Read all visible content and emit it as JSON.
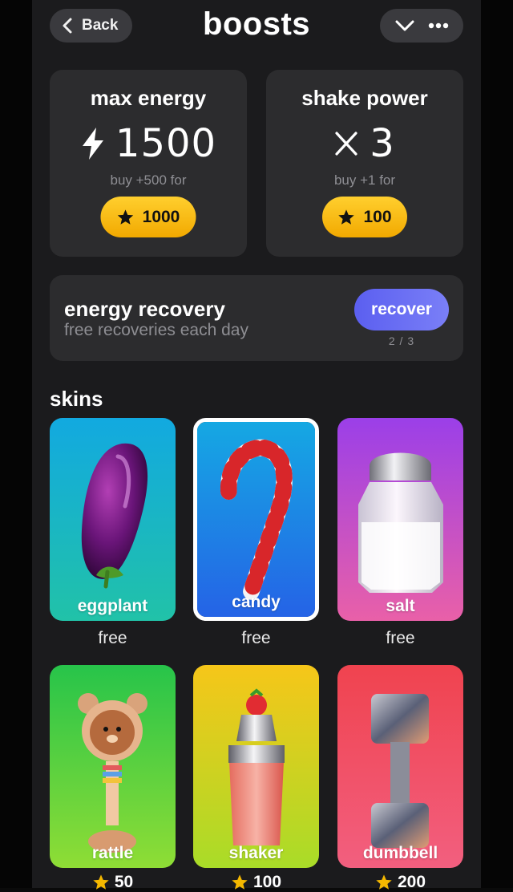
{
  "header": {
    "back_label": "Back",
    "title": "boosts"
  },
  "max_energy": {
    "label": "max energy",
    "value": "1500",
    "buy_text": "buy +500 for",
    "price": "1000"
  },
  "shake_power": {
    "label": "shake power",
    "value": "3",
    "buy_text": "buy +1 for",
    "price": "100"
  },
  "recovery": {
    "title": "energy recovery",
    "subtitle": "free recoveries each day",
    "button_label": "recover",
    "count": "2 / 3"
  },
  "skins": {
    "title": "skins",
    "items": [
      {
        "name": "eggplant",
        "price": "free",
        "selected": false
      },
      {
        "name": "candy",
        "price": "free",
        "selected": true
      },
      {
        "name": "salt",
        "price": "free",
        "selected": false
      },
      {
        "name": "rattle",
        "price": "50",
        "selected": false
      },
      {
        "name": "shaker",
        "price": "100",
        "selected": false
      },
      {
        "name": "dumbbell",
        "price": "200",
        "selected": false
      }
    ]
  },
  "colors": {
    "accent_gold": "#f5b800",
    "accent_purple": "#6a6ef3",
    "card_bg": "#2c2c2e"
  },
  "icons": {
    "back": "chevron-left-icon",
    "menu_toggle": "chevron-down-icon",
    "more": "more-dots-icon",
    "energy": "lightning-icon",
    "multiplier": "times-icon",
    "currency": "star-icon"
  }
}
